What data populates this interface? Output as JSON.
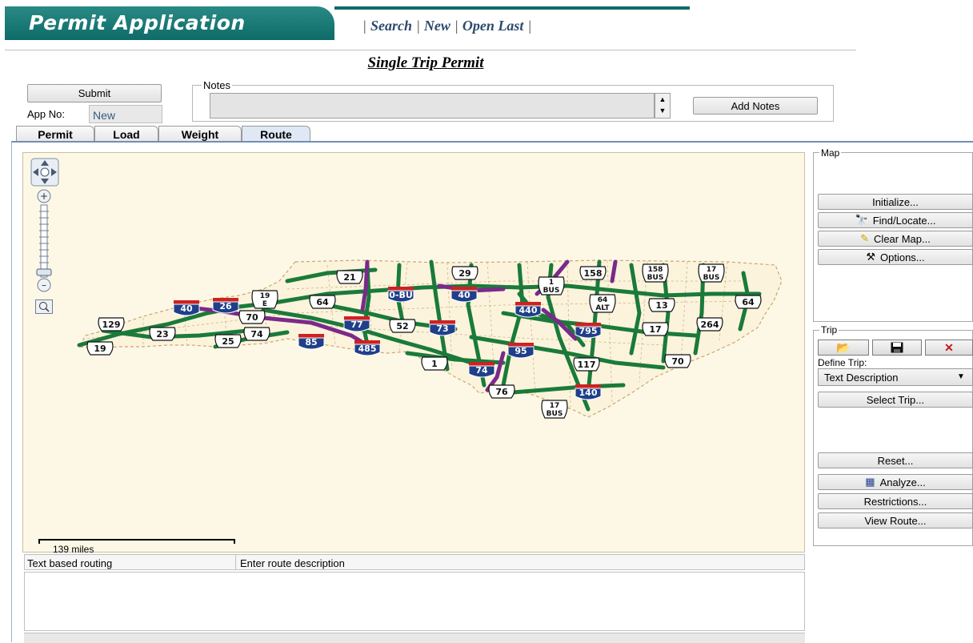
{
  "header": {
    "title": "Permit Application",
    "links": [
      "Search",
      "New",
      "Open Last"
    ],
    "separator": "|"
  },
  "form_title": "Single Trip Permit",
  "top": {
    "submit_label": "Submit",
    "app_no_label": "App No:",
    "app_no_value": "New",
    "notes_legend": "Notes",
    "add_notes_label": "Add Notes"
  },
  "tabs": [
    "Permit",
    "Load",
    "Weight",
    "Route"
  ],
  "active_tab": "Route",
  "map": {
    "scale_label": "139 miles",
    "shields": {
      "interstate": [
        "40",
        "26",
        "77",
        "485",
        "85",
        "40",
        "440",
        "73",
        "795",
        "95",
        "74",
        "140",
        "0-BU"
      ],
      "us": [
        "21",
        "29",
        "158",
        "158 BUS",
        "17 BUS",
        "1 BUS",
        "19 E",
        "64",
        "64 ALT",
        "13",
        "64",
        "129",
        "23",
        "70",
        "74",
        "25",
        "52",
        "17",
        "264",
        "19",
        "1",
        "117",
        "70",
        "76",
        "17 BUS"
      ]
    }
  },
  "routing": {
    "col1": "Text based routing",
    "col2": "Enter route description"
  },
  "right_panel": {
    "map_legend": "Map",
    "map_buttons": [
      {
        "label": "Initialize...",
        "icon": ""
      },
      {
        "label": "Find/Locate...",
        "icon": "binoculars-icon"
      },
      {
        "label": "Clear Map...",
        "icon": "eraser-icon"
      },
      {
        "label": "Options...",
        "icon": "tools-icon"
      }
    ],
    "trip_legend": "Trip",
    "trip_icons": [
      "open-folder-icon",
      "save-disk-icon",
      "delete-x-icon"
    ],
    "define_trip_label": "Define Trip:",
    "define_trip_value": "Text Description",
    "select_trip_label": "Select Trip...",
    "reset_label": "Reset...",
    "analyze_label": "Analyze...",
    "restrictions_label": "Restrictions...",
    "view_route_label": "View Route..."
  },
  "colors": {
    "header_teal": "#0e6b68",
    "map_bg": "#fdf8e6",
    "route_green": "#1a7a3a",
    "route_purple": "#7a2a8a",
    "interstate_blue": "#1f3f8a",
    "interstate_red": "#cc2222"
  }
}
